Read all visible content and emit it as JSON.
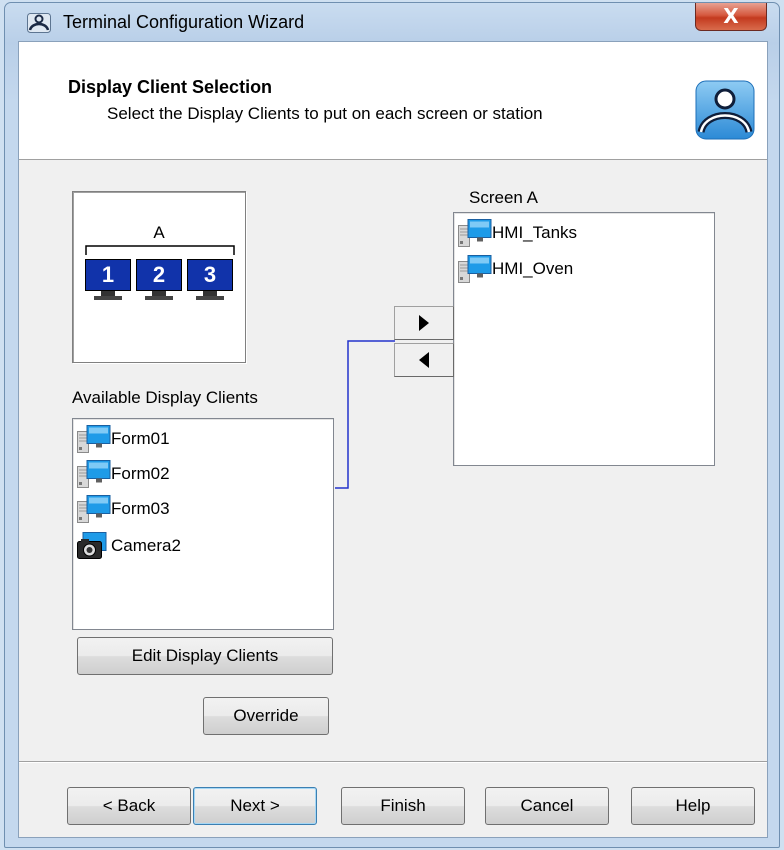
{
  "window": {
    "title": "Terminal Configuration Wizard",
    "close_glyph": "X"
  },
  "header": {
    "title": "Display Client Selection",
    "subtitle": "Select the Display Clients to put on each screen or station",
    "logo_icon": "thinmanager-logo-icon"
  },
  "preview": {
    "group_label": "A",
    "monitors": [
      "1",
      "2",
      "3"
    ]
  },
  "screen_list": {
    "label": "Screen A",
    "items": [
      {
        "label": "HMI_Tanks",
        "icon": "terminal-client-icon"
      },
      {
        "label": "HMI_Oven",
        "icon": "terminal-client-icon"
      }
    ]
  },
  "transfer": {
    "add_icon": "arrow-right-icon",
    "remove_icon": "arrow-left-icon"
  },
  "available_list": {
    "label": "Available Display Clients",
    "items": [
      {
        "label": "Form01",
        "icon": "terminal-client-icon"
      },
      {
        "label": "Form02",
        "icon": "terminal-client-icon"
      },
      {
        "label": "Form03",
        "icon": "terminal-client-icon"
      },
      {
        "label": "Camera2",
        "icon": "camera-client-icon"
      }
    ]
  },
  "buttons": {
    "edit_display_clients": "Edit Display Clients",
    "override": "Override",
    "back": "< Back",
    "next": "Next >",
    "finish": "Finish",
    "cancel": "Cancel",
    "help": "Help"
  },
  "colors": {
    "monitor": "#1133aa",
    "connector": "#2233cc",
    "close": "#c33a1f"
  }
}
